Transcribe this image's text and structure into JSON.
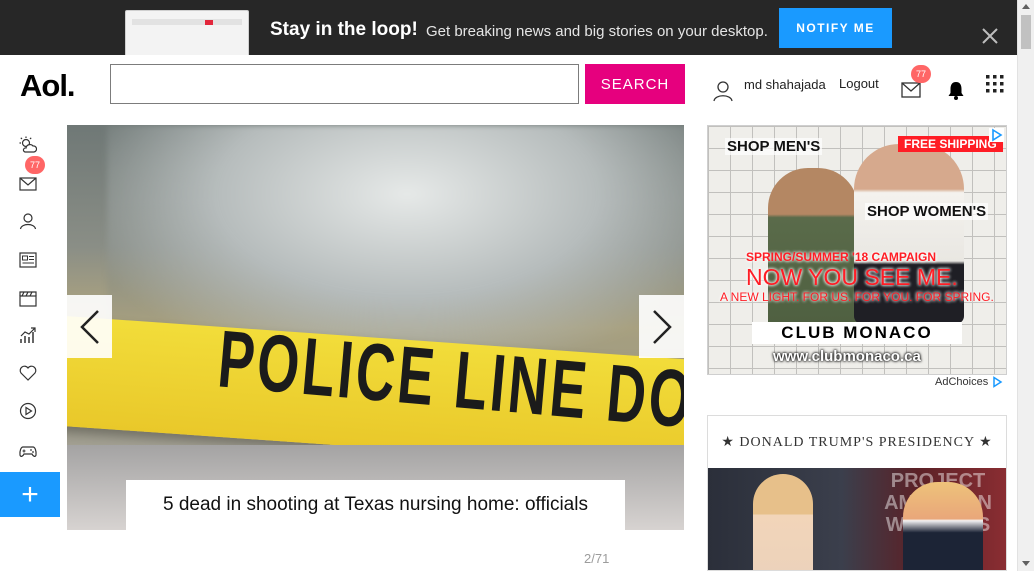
{
  "promo": {
    "title": "Stay in the loop!",
    "subtitle": "Get breaking news and big stories on your desktop.",
    "notify_label": "NOTIFY ME",
    "close_icon": "close-icon"
  },
  "header": {
    "logo": "Aol.",
    "search_placeholder": "",
    "search_label": "SEARCH",
    "user_name": "md shahajada",
    "logout_label": "Logout",
    "mail_count": "77",
    "icons": [
      "user-icon",
      "mail-icon",
      "bell-icon",
      "apps-grid-icon"
    ]
  },
  "rail": {
    "items": [
      {
        "name": "weather",
        "icon": "weather-icon"
      },
      {
        "name": "mail",
        "icon": "mail-icon",
        "badge": "77"
      },
      {
        "name": "profile",
        "icon": "user-icon"
      },
      {
        "name": "news",
        "icon": "newspaper-icon"
      },
      {
        "name": "entertainment",
        "icon": "clapperboard-icon"
      },
      {
        "name": "finance",
        "icon": "chart-icon"
      },
      {
        "name": "lifestyle",
        "icon": "heart-icon"
      },
      {
        "name": "video",
        "icon": "play-icon"
      },
      {
        "name": "games",
        "icon": "gamepad-icon"
      }
    ],
    "add_label": "+"
  },
  "hero": {
    "caption": "5 dead in shooting at Texas nursing home: officials",
    "tape_text": "POLICE LINE DO NOT CROSS",
    "counter": "2/71",
    "prev_icon": "chevron-left-icon",
    "next_icon": "chevron-right-icon"
  },
  "ad": {
    "shop_men": "SHOP MEN'S",
    "free_shipping": "FREE SHIPPING",
    "shop_women": "SHOP WOMEN'S",
    "campaign": "SPRING/SUMMER '18 CAMPAIGN",
    "headline": "NOW YOU SEE ME.",
    "tagline": "A NEW LIGHT. FOR US. FOR YOU. FOR SPRING.",
    "brand": "CLUB MONACO",
    "url": "www.clubmonaco.ca",
    "adchoices": "AdChoices"
  },
  "card": {
    "title": "★ DONALD TRUMP'S PRESIDENCY ★",
    "image_sign": "PROJECT AMERICAN WORKERS"
  },
  "colors": {
    "accent_blue": "#1a9aff",
    "search_pink": "#e6007e",
    "badge_red": "#ff6666",
    "promo_bg": "#272727"
  }
}
